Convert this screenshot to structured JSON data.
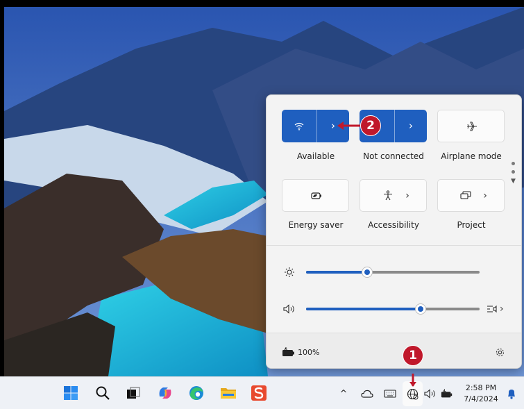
{
  "quick_settings": {
    "tiles": [
      {
        "id": "wifi",
        "label": "Available",
        "state": "on",
        "icon": "wifi-icon"
      },
      {
        "id": "bluetooth",
        "label": "Not connected",
        "state": "on",
        "icon": "bluetooth-icon"
      },
      {
        "id": "airplane",
        "label": "Airplane mode",
        "state": "off",
        "icon": "airplane-icon"
      },
      {
        "id": "energy",
        "label": "Energy saver",
        "state": "off",
        "icon": "energy-saver-icon"
      },
      {
        "id": "accessibility",
        "label": "Accessibility",
        "state": "off",
        "icon": "accessibility-icon"
      },
      {
        "id": "project",
        "label": "Project",
        "state": "off",
        "icon": "project-icon"
      }
    ],
    "brightness_level": 0.35,
    "volume_level": 0.66,
    "battery_text": "100%",
    "accent": "#1f5fbf"
  },
  "taskbar": {
    "apps": [
      "start-icon",
      "search-icon",
      "task-view-icon",
      "copilot-icon",
      "edge-icon",
      "file-explorer-icon",
      "store-icon"
    ],
    "tray_overflow": "^",
    "time": "2:58 PM",
    "date": "7/4/2024"
  },
  "callouts": {
    "one": "1",
    "two": "2",
    "color": "#c0182b"
  }
}
